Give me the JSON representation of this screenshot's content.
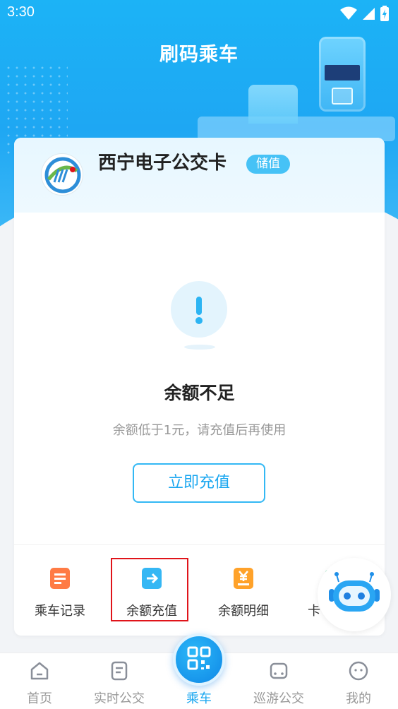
{
  "status_bar": {
    "time": "3:30"
  },
  "header": {
    "title": "刷码乘车"
  },
  "card": {
    "name": "西宁电子公交卡",
    "badge": "储值"
  },
  "status": {
    "title": "余额不足",
    "description": "余额低于1元，请充值后再使用",
    "button_label": "立即充值"
  },
  "shortcuts": [
    {
      "label": "乘车记录",
      "icon": "ride-record-icon"
    },
    {
      "label": "余额充值",
      "icon": "balance-recharge-icon"
    },
    {
      "label": "余额明细",
      "icon": "balance-detail-icon"
    },
    {
      "label": "卡",
      "icon": "card-icon"
    }
  ],
  "bottom_nav": [
    {
      "label": "首页",
      "icon": "home-icon"
    },
    {
      "label": "实时公交",
      "icon": "realtime-bus-icon"
    },
    {
      "label": "乘车",
      "icon": "qr-code-icon"
    },
    {
      "label": "巡游公交",
      "icon": "tour-bus-icon"
    },
    {
      "label": "我的",
      "icon": "profile-icon"
    }
  ],
  "colors": {
    "primary": "#1ba7f0",
    "highlight": "#e0141a",
    "warning_accent": "#2cb4f3"
  }
}
